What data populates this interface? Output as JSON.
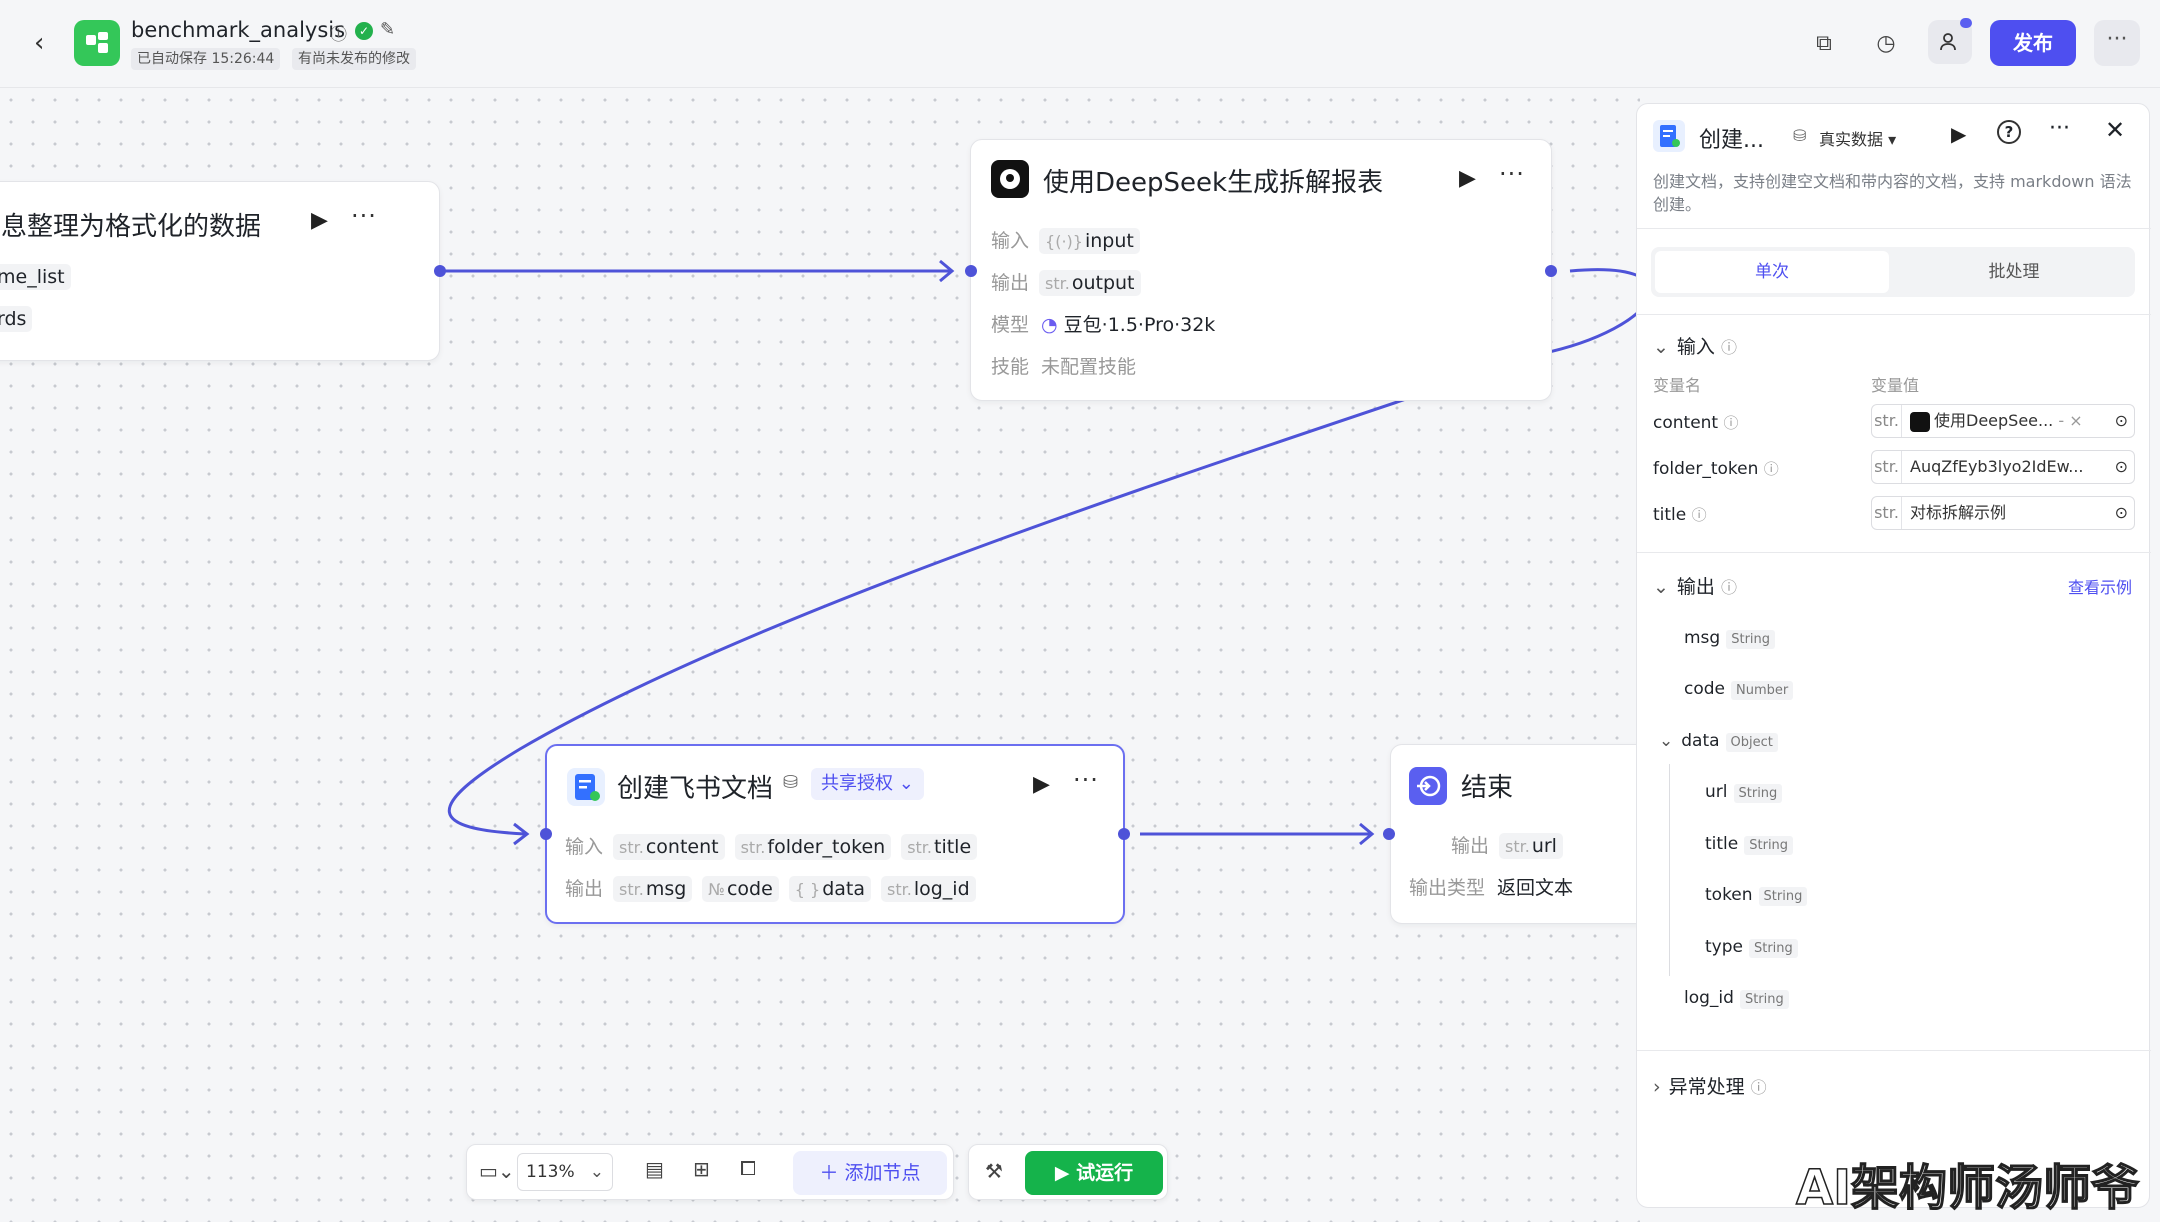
{
  "header": {
    "app_name": "benchmark_analysis",
    "autosave": "已自动保存 15:26:44",
    "unpublished": "有尚未发布的修改",
    "publish_label": "发布",
    "more": "···"
  },
  "nodes": {
    "format": {
      "title": "息整理为格式化的数据",
      "out1": "me_list",
      "out2": "rds"
    },
    "deepseek": {
      "title": "使用DeepSeek生成拆解报表",
      "input_label": "输入",
      "input_type": "{(·)}",
      "input_name": "input",
      "output_label": "输出",
      "output_type": "str.",
      "output_name": "output",
      "model_label": "模型",
      "model_value": "豆包·1.5·Pro·32k",
      "skill_label": "技能",
      "skill_value": "未配置技能"
    },
    "feishu": {
      "title": "创建飞书文档",
      "share": "共享授权",
      "input_label": "输入",
      "inputs": [
        {
          "type": "str.",
          "name": "content"
        },
        {
          "type": "str.",
          "name": "folder_token"
        },
        {
          "type": "str.",
          "name": "title"
        }
      ],
      "output_label": "输出",
      "outputs": [
        {
          "type": "str.",
          "name": "msg"
        },
        {
          "type": "№",
          "name": "code"
        },
        {
          "type": "{ }",
          "name": "data"
        },
        {
          "type": "str.",
          "name": "log_id"
        }
      ]
    },
    "end": {
      "title": "结束",
      "output_label": "输出",
      "output_type": "str.",
      "output_name": "url",
      "otype_label": "输出类型",
      "otype_value": "返回文本"
    }
  },
  "panel": {
    "title": "创建...",
    "data_mode": "真实数据",
    "description": "创建文档，支持创建空文档和带内容的文档，支持 markdown 语法创建。",
    "tab_single": "单次",
    "tab_batch": "批处理",
    "input_section": "输入",
    "col_var": "变量名",
    "col_val": "变量值",
    "fields": [
      {
        "name": "content",
        "type": "str.",
        "value": "使用DeepSee...",
        "suffix": "-"
      },
      {
        "name": "folder_token",
        "type": "str.",
        "value": "AuqZfEyb3lyo2IdEw..."
      },
      {
        "name": "title",
        "type": "str.",
        "value": "对标拆解示例"
      }
    ],
    "output_section": "输出",
    "view_example": "查看示例",
    "outputs": [
      {
        "name": "msg",
        "type": "String"
      },
      {
        "name": "code",
        "type": "Number"
      },
      {
        "name": "data",
        "type": "Object"
      },
      {
        "name": "url",
        "type": "String"
      },
      {
        "name": "title",
        "type": "String"
      },
      {
        "name": "token",
        "type": "String"
      },
      {
        "name": "type",
        "type": "String"
      },
      {
        "name": "log_id",
        "type": "String"
      }
    ],
    "error_section": "异常处理"
  },
  "toolbar": {
    "zoom": "113%",
    "add_node": "添加节点",
    "run": "试运行"
  },
  "watermark": "AI架构师汤师爷",
  "colors": {
    "accent": "#4e4ff0",
    "edge": "#4e53d8",
    "run": "#15b34b"
  }
}
